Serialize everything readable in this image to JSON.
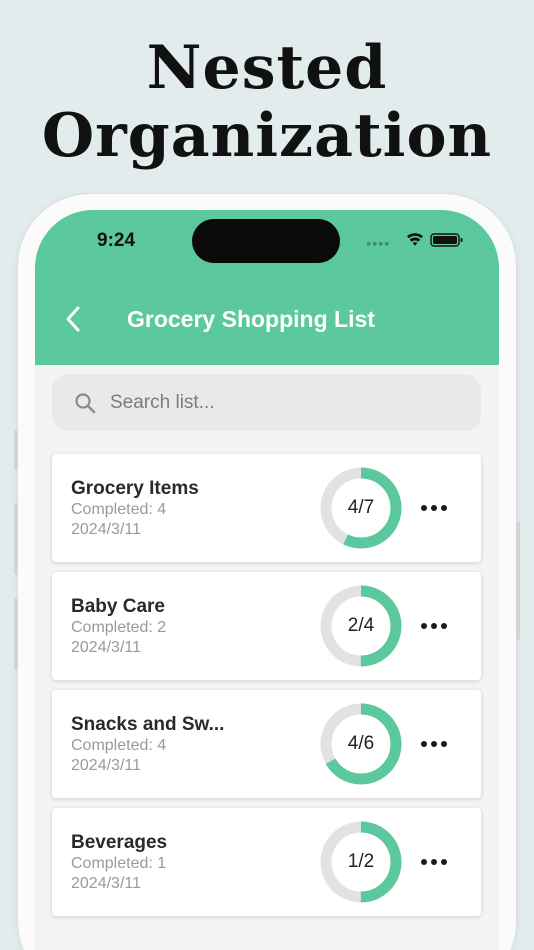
{
  "headline": {
    "line1": "Nested",
    "line2": "Organization"
  },
  "status_bar": {
    "time": "9:24"
  },
  "nav": {
    "title": "Grocery Shopping List",
    "back_icon": "chevron-left-icon"
  },
  "search": {
    "placeholder": "Search list...",
    "value": "",
    "icon": "search-icon"
  },
  "colors": {
    "accent": "#5bc89e",
    "ring_track": "#e2e2e2"
  },
  "items": [
    {
      "name": "Grocery Items",
      "completed": "Completed: 4",
      "date": "2024/3/11",
      "progress": "4/7",
      "done": 4,
      "total": 7
    },
    {
      "name": "Baby Care",
      "completed": "Completed: 2",
      "date": "2024/3/11",
      "progress": "2/4",
      "done": 2,
      "total": 4
    },
    {
      "name": "Snacks and Sw...",
      "completed": "Completed: 4",
      "date": "2024/3/11",
      "progress": "4/6",
      "done": 4,
      "total": 6
    },
    {
      "name": "Beverages",
      "completed": "Completed: 1",
      "date": "2024/3/11",
      "progress": "1/2",
      "done": 1,
      "total": 2
    }
  ]
}
